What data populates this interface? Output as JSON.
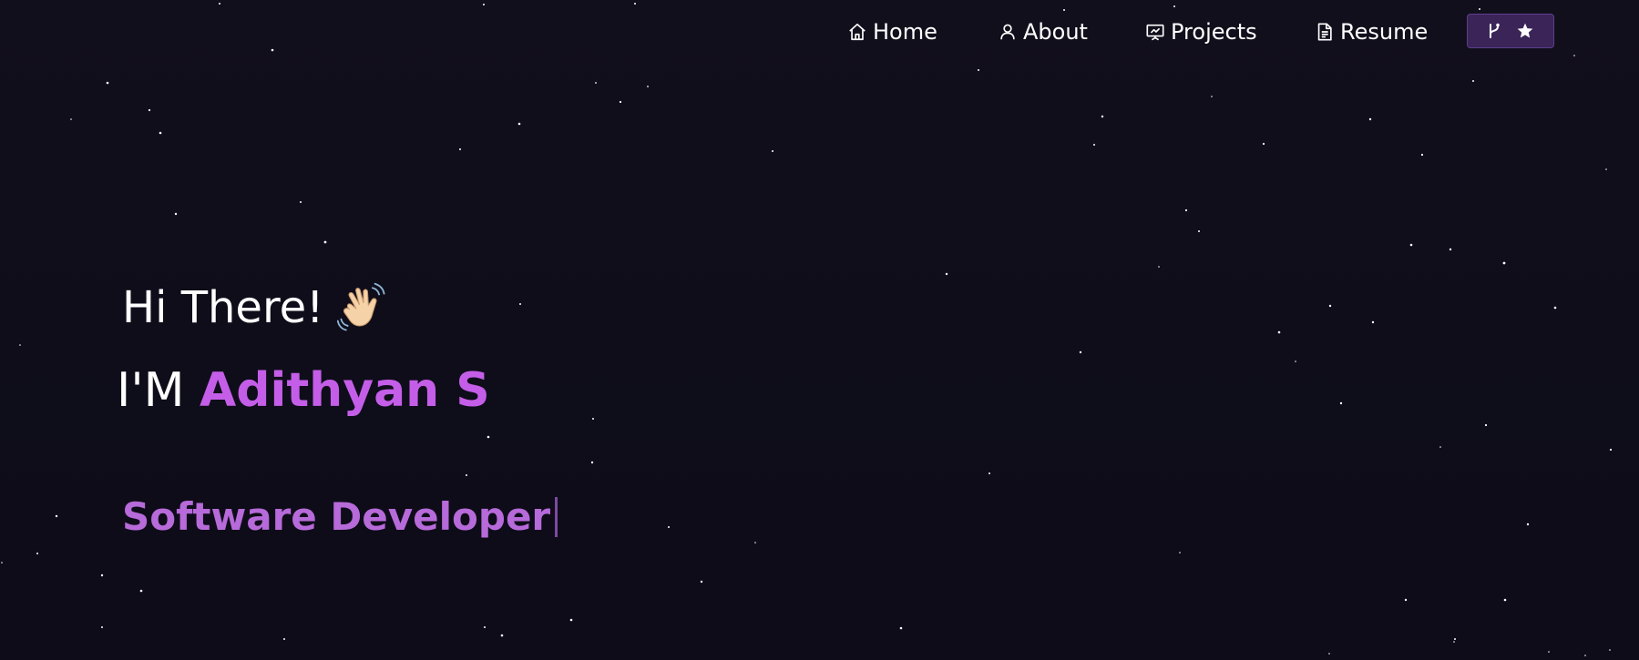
{
  "nav": {
    "items": [
      {
        "label": "Home",
        "icon": "home-icon"
      },
      {
        "label": "About",
        "icon": "user-icon"
      },
      {
        "label": "Projects",
        "icon": "presentation-icon"
      },
      {
        "label": "Resume",
        "icon": "document-icon"
      }
    ],
    "repo_button": {
      "icons": [
        "git-fork-icon",
        "star-icon"
      ]
    }
  },
  "hero": {
    "greeting": "Hi There!",
    "greeting_emoji": "waving-hand-icon",
    "intro_prefix": "I'M ",
    "name": "Adithyan S",
    "role": "Software Developer"
  },
  "colors": {
    "background": "#100d1a",
    "accent": "#c45ee8",
    "role_text": "#b76ad9",
    "button_bg": "#3a2458"
  }
}
